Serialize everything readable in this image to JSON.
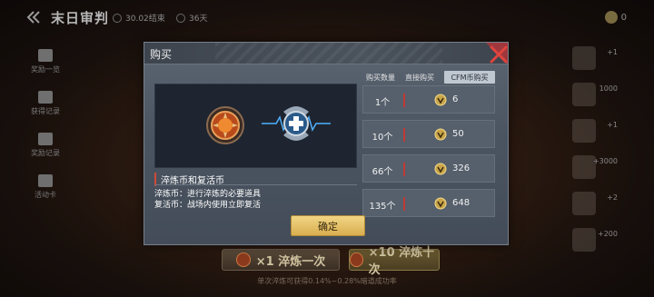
{
  "background": {
    "title": "末日审判",
    "info_items": [
      "30.02结束",
      "36天"
    ],
    "coin_count": "0",
    "left_menu": [
      "奖励一览",
      "获得记录",
      "奖励记录",
      "活动卡"
    ],
    "right_values": [
      "+1",
      "1000",
      "+1",
      "+3000",
      "+2",
      "+200"
    ],
    "draw_one_label": "×1 淬炼一次",
    "draw_ten_label": "×10 淬炼十次",
    "bottom_note": "单次淬炼可获得0.14%~0.28%暗道成功率"
  },
  "modal": {
    "title": "购买",
    "product_name": "淬炼币和复活币",
    "desc_1": "淬炼币：进行淬炼的必要道具",
    "desc_2": "复活币：战场内使用立即复活",
    "tabs": {
      "quantity": "购买数量",
      "direct": "直接购买",
      "cfm": "CFM币购买"
    },
    "options": [
      {
        "qty": "1个",
        "price": "6"
      },
      {
        "qty": "10个",
        "price": "50"
      },
      {
        "qty": "66个",
        "price": "326"
      },
      {
        "qty": "135个",
        "price": "648"
      }
    ],
    "confirm_label": "确定"
  },
  "colors": {
    "accent_red": "#c13a35",
    "confirm_gold": "#e6c26a",
    "modal_bg": "#4b5561"
  },
  "icons": [
    "back-icon",
    "close-icon",
    "quench-coin-icon",
    "revive-coin-icon",
    "cfm-coin-icon"
  ]
}
